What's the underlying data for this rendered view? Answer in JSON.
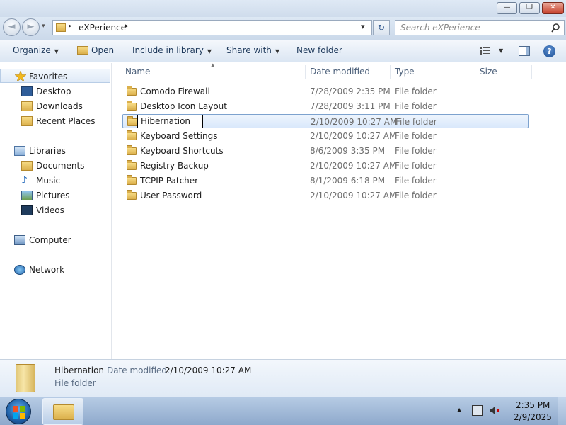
{
  "window": {
    "minimize_glyph": "—",
    "maximize_glyph": "❐",
    "close_glyph": "✕"
  },
  "nav": {
    "back_glyph": "◄",
    "forward_glyph": "►",
    "recent_glyph": "▾",
    "breadcrumb_sep": "▸",
    "location": "eXPerience",
    "dropdown_glyph": "▾",
    "refresh_glyph": "↻",
    "search_placeholder": "Search eXPerience",
    "search_icon": "search-icon"
  },
  "toolbar": {
    "organize": "Organize",
    "open": "Open",
    "include_in_library": "Include in library",
    "share_with": "Share with",
    "new_folder": "New folder",
    "caret": "▼",
    "help": "?"
  },
  "sidebar": {
    "favorites": "Favorites",
    "desktop": "Desktop",
    "downloads": "Downloads",
    "recent_places": "Recent Places",
    "libraries": "Libraries",
    "documents": "Documents",
    "music": "Music",
    "pictures": "Pictures",
    "videos": "Videos",
    "computer": "Computer",
    "network": "Network"
  },
  "columns": {
    "name": "Name",
    "date_modified": "Date modified",
    "type": "Type",
    "size": "Size"
  },
  "files": [
    {
      "name": "Comodo Firewall",
      "date": "7/28/2009 2:35 PM",
      "type": "File folder"
    },
    {
      "name": "Desktop Icon Layout",
      "date": "7/28/2009 3:11 PM",
      "type": "File folder"
    },
    {
      "name": "Hibernation",
      "date": "2/10/2009 10:27 AM",
      "type": "File folder"
    },
    {
      "name": "Keyboard Settings",
      "date": "2/10/2009 10:27 AM",
      "type": "File folder"
    },
    {
      "name": "Keyboard Shortcuts",
      "date": "8/6/2009 3:35 PM",
      "type": "File folder"
    },
    {
      "name": "Registry Backup",
      "date": "2/10/2009 10:27 AM",
      "type": "File folder"
    },
    {
      "name": "TCPIP Patcher",
      "date": "8/1/2009 6:18 PM",
      "type": "File folder"
    },
    {
      "name": "User Password",
      "date": "2/10/2009 10:27 AM",
      "type": "File folder"
    }
  ],
  "details": {
    "name": "Hibernation",
    "date_label": "Date modified:",
    "date_value": "2/10/2009 10:27 AM",
    "type": "File folder"
  },
  "taskbar": {
    "show_hidden_glyph": "▲",
    "time": "2:35 PM",
    "date": "2/9/2025"
  },
  "colors": {
    "accent": "#1e395b",
    "selection_border": "#7da2ce",
    "folder": "#dbb04c"
  }
}
